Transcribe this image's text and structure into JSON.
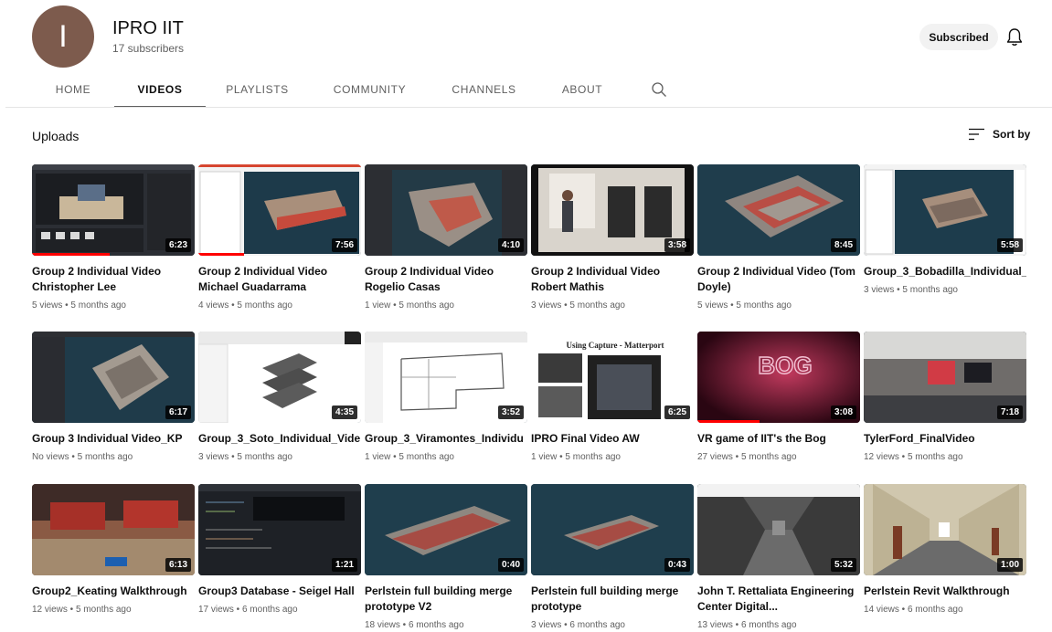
{
  "channel": {
    "avatar_letter": "I",
    "name": "IPRO IIT",
    "subscribers": "17 subscribers",
    "subscribed_label": "Subscribed"
  },
  "tabs": [
    "HOME",
    "VIDEOS",
    "PLAYLISTS",
    "COMMUNITY",
    "CHANNELS",
    "ABOUT"
  ],
  "active_tab": "VIDEOS",
  "section": {
    "title": "Uploads",
    "sort_label": "Sort by"
  },
  "videos": [
    {
      "title": "Group 2 Individual Video Christopher Lee",
      "meta": "5 views • 5 months ago",
      "duration": "6:23",
      "watched": 0.48
    },
    {
      "title": "Group 2 Individual Video Michael Guadarrama",
      "meta": "4 views • 5 months ago",
      "duration": "7:56",
      "watched": 0.28
    },
    {
      "title": "Group 2 Individual Video Rogelio Casas",
      "meta": "1 view • 5 months ago",
      "duration": "4:10",
      "watched": 0
    },
    {
      "title": "Group 2 Individual Video Robert Mathis",
      "meta": "3 views • 5 months ago",
      "duration": "3:58",
      "watched": 0
    },
    {
      "title": "Group 2 Individual Video (Tom Doyle)",
      "meta": "5 views • 5 months ago",
      "duration": "8:45",
      "watched": 0
    },
    {
      "title": "Group_3_Bobadilla_Individual_",
      "meta": "3 views • 5 months ago",
      "duration": "5:58",
      "watched": 0
    },
    {
      "title": "Group 3 Individual Video_KP",
      "meta": "No views • 5 months ago",
      "duration": "6:17",
      "watched": 0
    },
    {
      "title": "Group_3_Soto_Individual_Vide",
      "meta": "3 views • 5 months ago",
      "duration": "4:35",
      "watched": 0
    },
    {
      "title": "Group_3_Viramontes_Individu",
      "meta": "1 view • 5 months ago",
      "duration": "3:52",
      "watched": 0
    },
    {
      "title": "IPRO Final Video AW",
      "meta": "1 view • 5 months ago",
      "duration": "6:25",
      "watched": 0
    },
    {
      "title": "VR game of IIT's the Bog",
      "meta": "27 views • 5 months ago",
      "duration": "3:08",
      "watched": 0.38
    },
    {
      "title": "TylerFord_FinalVideo",
      "meta": "12 views • 5 months ago",
      "duration": "7:18",
      "watched": 0
    },
    {
      "title": "Group2_Keating Walkthrough",
      "meta": "12 views • 5 months ago",
      "duration": "6:13",
      "watched": 0
    },
    {
      "title": "Group3 Database - Seigel Hall",
      "meta": "17 views • 6 months ago",
      "duration": "1:21",
      "watched": 0
    },
    {
      "title": "Perlstein full building merge prototype V2",
      "meta": "18 views • 6 months ago",
      "duration": "0:40",
      "watched": 0
    },
    {
      "title": "Perlstein full building merge prototype",
      "meta": "3 views • 6 months ago",
      "duration": "0:43",
      "watched": 0
    },
    {
      "title": "John T. Rettaliata Engineering Center Digital...",
      "meta": "13 views • 6 months ago",
      "duration": "5:32",
      "watched": 0
    },
    {
      "title": "Perlstein Revit Walkthrough",
      "meta": "14 views • 6 months ago",
      "duration": "1:00",
      "watched": 0
    }
  ],
  "thumbnail_overlay_text": {
    "video_10": "Using Capture - Matterport",
    "video_11": "BOG"
  }
}
